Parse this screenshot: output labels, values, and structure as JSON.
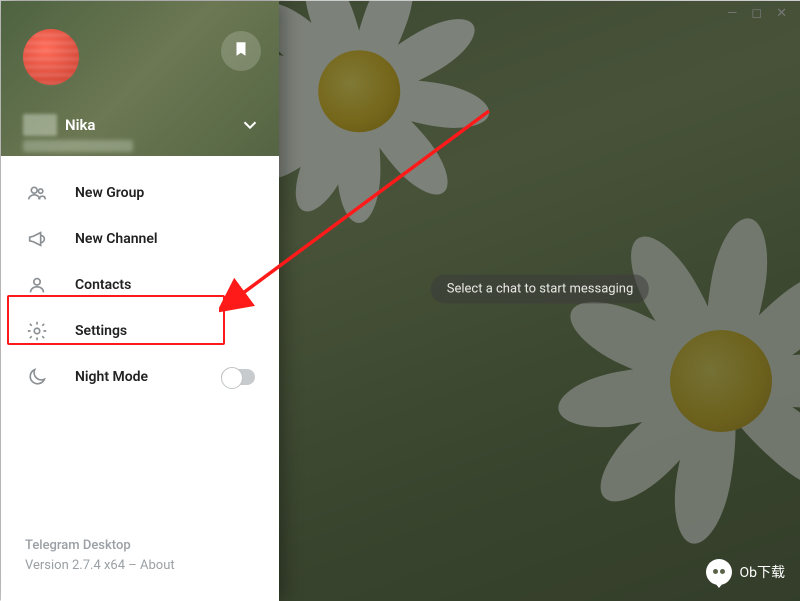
{
  "window_controls": {
    "min": "—",
    "max": "◻",
    "close": "✕"
  },
  "profile": {
    "username": "Nika"
  },
  "menu": {
    "new_group": "New Group",
    "new_channel": "New Channel",
    "contacts": "Contacts",
    "settings": "Settings",
    "night_mode": "Night Mode",
    "night_mode_on": false
  },
  "footer": {
    "app_name": "Telegram Desktop",
    "version_line": "Version 2.7.4 x64 – About"
  },
  "chat": {
    "placeholder": "Select a chat to start messaging"
  },
  "watermark": {
    "text": "Ob下载"
  }
}
